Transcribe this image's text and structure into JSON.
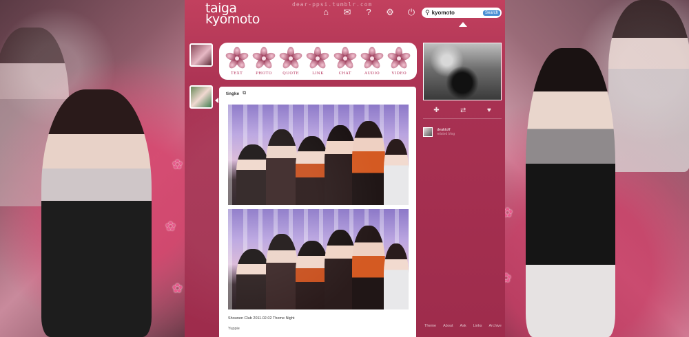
{
  "blog": {
    "title_line1": "taiga",
    "title_line2": "kyomoto",
    "tagline": "dear-ppsi.tumblr.com"
  },
  "nav": {
    "icons": [
      "home-icon",
      "mail-icon",
      "help-icon",
      "settings-icon",
      "power-icon"
    ]
  },
  "search": {
    "value": "kyomoto",
    "button_label": "Search"
  },
  "post_types": [
    {
      "label": "TEXT"
    },
    {
      "label": "PHOTO"
    },
    {
      "label": "QUOTE"
    },
    {
      "label": "LINK"
    },
    {
      "label": "CHAT"
    },
    {
      "label": "AUDIO"
    },
    {
      "label": "VIDEO"
    }
  ],
  "post": {
    "author": "tingke",
    "caption": "Shounen Club 2011.02.02 Theme Night",
    "tags": "Yuppie"
  },
  "sidebar": {
    "actions": [
      "plus-icon",
      "reblog-icon",
      "heart-icon"
    ],
    "follower_name": "deaktoff",
    "follower_sub": "related blog"
  },
  "footer": {
    "links": [
      "Theme",
      "About",
      "Ask",
      "Links",
      "Archive"
    ]
  },
  "colors": {
    "accent": "#b22a55",
    "center_bg": "#a83152",
    "blossom": "#e85a8c"
  }
}
